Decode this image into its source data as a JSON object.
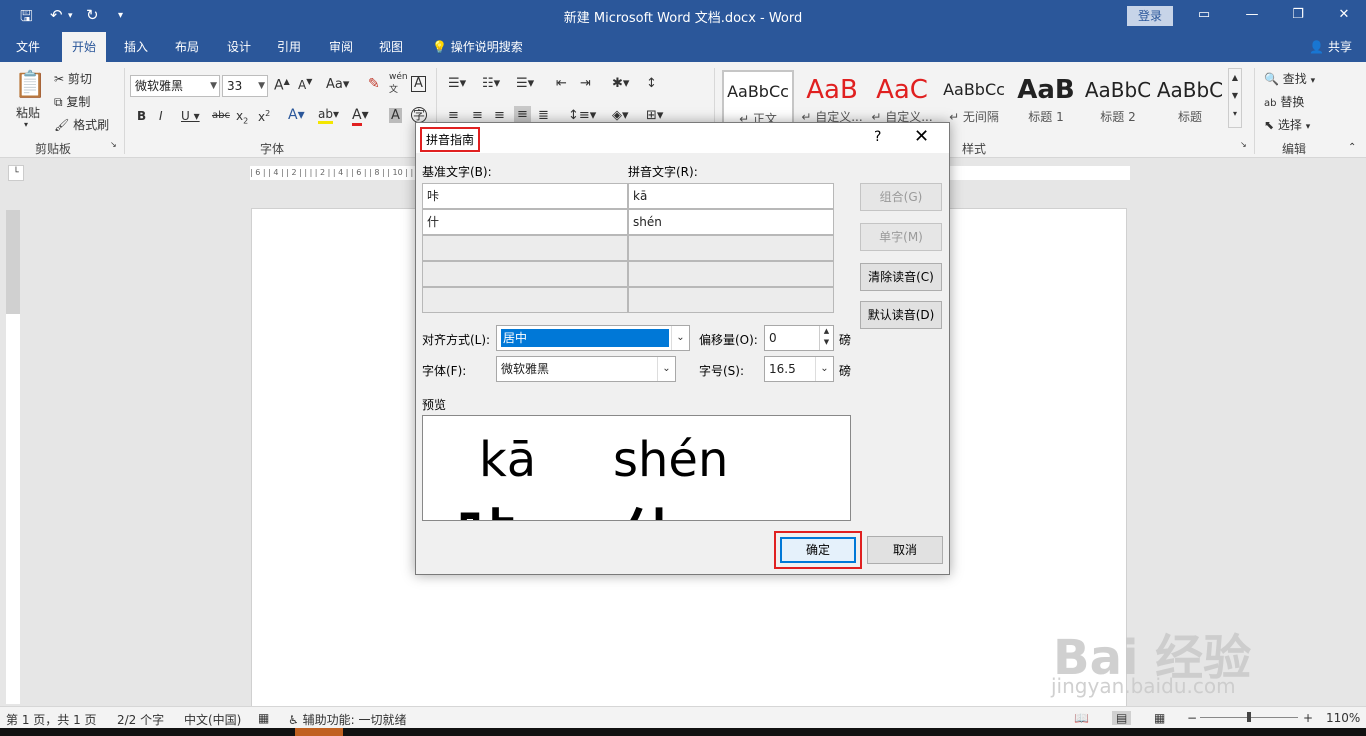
{
  "titlebar": {
    "title": "新建 Microsoft Word 文档.docx  -  Word",
    "login": "登录",
    "save_icon": "save-icon",
    "undo_icon": "undo-icon",
    "redo_icon": "redo-icon",
    "customize_icon": "customize-qa-icon"
  },
  "tabs": [
    "文件",
    "开始",
    "插入",
    "布局",
    "设计",
    "引用",
    "审阅",
    "视图"
  ],
  "tell_me": "操作说明搜索",
  "share": "共享",
  "ribbon": {
    "paste": "粘贴",
    "cut": "剪切",
    "copy": "复制",
    "format_painter": "格式刷",
    "clipboard_label": "剪贴板",
    "font_name": "微软雅黑",
    "font_size": "33",
    "font_label": "字体",
    "styles": [
      {
        "sample": "AaBbCc",
        "name": "↵ 正文"
      },
      {
        "sample": "AaB",
        "name": "↵ 自定义..."
      },
      {
        "sample": "AaC",
        "name": "↵ 自定义..."
      },
      {
        "sample": "AaBbCc",
        "name": "↵ 无间隔"
      },
      {
        "sample": "AaB",
        "name": "标题 1"
      },
      {
        "sample": "AaBbC",
        "name": "标题 2"
      },
      {
        "sample": "AaBbC",
        "name": "标题"
      }
    ],
    "styles_label": "样式",
    "find": "查找",
    "replace": "替换",
    "select": "选择",
    "editing_label": "编辑"
  },
  "ruler_text": "| 6 | | 4 | | 2 | | | | 2 | | 4 | | 6 | | 8 | | 10 | | 12 | | 14 | | 16 | | 18 | | 20 | | 22 | | 24 | | 26 | | 28 | | 30 | | 32 | | 34 | | 36 | | 38 | | 40 | | 42",
  "dialog": {
    "title": "拼音指南",
    "help": "?",
    "close": "✕",
    "base_header": "基准文字(B):",
    "ruby_header": "拼音文字(R):",
    "rows": [
      {
        "base": "咔",
        "ruby": "kā"
      },
      {
        "base": "什",
        "ruby": "shén"
      },
      {
        "base": "",
        "ruby": ""
      },
      {
        "base": "",
        "ruby": ""
      },
      {
        "base": "",
        "ruby": ""
      }
    ],
    "group_btn": "组合(G)",
    "mono_btn": "单字(M)",
    "clear_btn": "清除读音(C)",
    "default_btn": "默认读音(D)",
    "align_label": "对齐方式(L):",
    "align_value": "居中",
    "offset_label": "偏移量(O):",
    "offset_value": "0",
    "offset_unit": "磅",
    "font_label": "字体(F):",
    "font_value": "微软雅黑",
    "size_label": "字号(S):",
    "size_value": "16.5",
    "size_unit": "磅",
    "preview_label": "预览",
    "preview": {
      "py1": "kā",
      "py2": "shén",
      "ch1": "咔",
      "ch2": "什"
    },
    "ok": "确定",
    "cancel": "取消"
  },
  "status": {
    "page": "第 1 页，共 1 页",
    "words": "2/2 个字",
    "language": "中文(中国)",
    "accessibility": "辅助功能: 一切就绪",
    "zoom": "110%"
  },
  "watermark": {
    "logo": "Bai 经验",
    "url": "jingyan.baidu.com"
  },
  "colors": {
    "accent": "#2b579a",
    "highlight": "#e02020",
    "selection": "#0078d7"
  }
}
